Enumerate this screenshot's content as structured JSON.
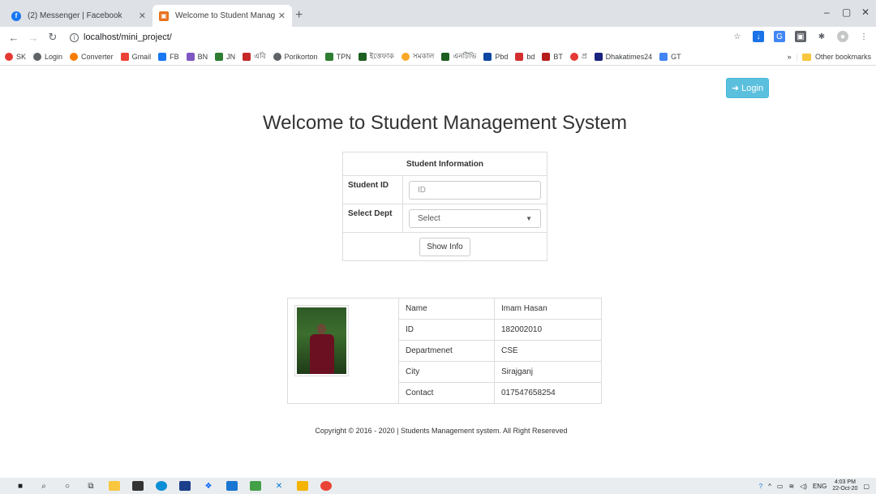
{
  "browser": {
    "tabs": [
      {
        "title": "(2) Messenger | Facebook",
        "active": false
      },
      {
        "title": "Welcome to Student Managemen",
        "active": true
      }
    ],
    "new_tab": "+",
    "window_controls": {
      "minimize": "–",
      "maximize": "▢",
      "close": "✕"
    },
    "url": "localhost/mini_project/",
    "bookmarks": [
      {
        "label": "SK",
        "color": "#e53935"
      },
      {
        "label": "Login",
        "color": "#5f6368"
      },
      {
        "label": "Converter",
        "color": "#f57c00"
      },
      {
        "label": "Gmail",
        "color": "#ea4335"
      },
      {
        "label": "FB",
        "color": "#1877f2"
      },
      {
        "label": "BN",
        "color": "#7e57c2"
      },
      {
        "label": "JN",
        "color": "#2e7d32"
      },
      {
        "label": "এবি",
        "color": "#c62828"
      },
      {
        "label": "Porikorton",
        "color": "#5f6368"
      },
      {
        "label": "TPN",
        "color": "#2e7d32"
      },
      {
        "label": "ইত্তেফাক",
        "color": "#1b5e20"
      },
      {
        "label": "সমকাল",
        "color": "#f9a825"
      },
      {
        "label": "এনটিভি",
        "color": "#1b5e20"
      },
      {
        "label": "Pbd",
        "color": "#0d47a1"
      },
      {
        "label": "bd",
        "color": "#d32f2f"
      },
      {
        "label": "BT",
        "color": "#b71c1c"
      },
      {
        "label": "প্র",
        "color": "#e53935"
      },
      {
        "label": "Dhakatimes24",
        "color": "#1a237e"
      },
      {
        "label": "GT",
        "color": "#4285f4"
      }
    ],
    "bookmarks_more": "»",
    "other_bookmarks": "Other bookmarks"
  },
  "page": {
    "login_label": "Login",
    "title": "Welcome to Student Management System",
    "form": {
      "header": "Student Information",
      "student_id_label": "Student ID",
      "student_id_placeholder": "ID",
      "dept_label": "Select Dept",
      "dept_selected": "Select",
      "show_button": "Show Info"
    },
    "result": {
      "rows": [
        {
          "key": "Name",
          "value": "Imam Hasan"
        },
        {
          "key": "ID",
          "value": "182002010"
        },
        {
          "key": "Departmenet",
          "value": "CSE"
        },
        {
          "key": "City",
          "value": "Sirajganj"
        },
        {
          "key": "Contact",
          "value": "017547658254"
        }
      ]
    },
    "copyright": "Copyright © 2016 - 2020 | Students Management system. All Right Resereved"
  },
  "taskbar": {
    "language": "ENG",
    "time": "4:03 PM",
    "date": "22-Oct-20"
  }
}
